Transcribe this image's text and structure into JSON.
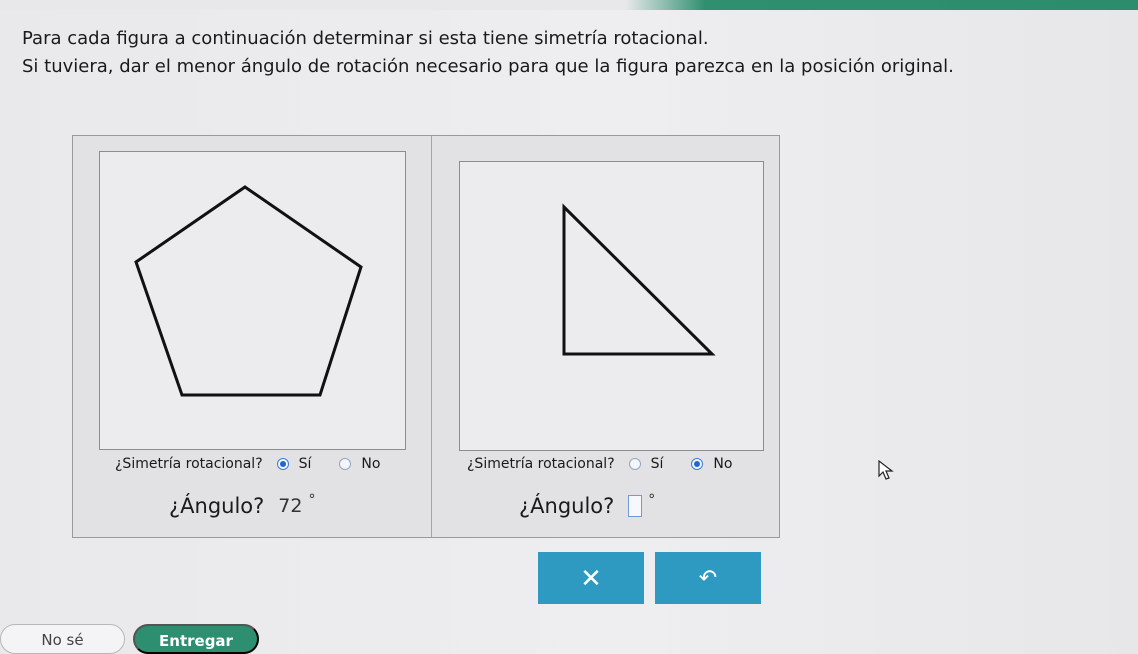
{
  "instructions": {
    "line1": "Para cada figura a continuación determinar si esta tiene simetría rotacional.",
    "line2": "Si tuviera, dar el menor ángulo de rotación necesario para que la figura parezca en la posición original."
  },
  "figures": [
    {
      "shape": "pentagon",
      "question": "¿Simetría rotacional?",
      "option_yes": "Sí",
      "option_no": "No",
      "selected": "Sí",
      "angle_label": "¿Ángulo?",
      "angle_value": "72",
      "degree_symbol": "°"
    },
    {
      "shape": "right-triangle",
      "question": "¿Simetría rotacional?",
      "option_yes": "Sí",
      "option_no": "No",
      "selected": "No",
      "angle_label": "¿Ángulo?",
      "angle_value": "",
      "degree_symbol": "°"
    }
  ],
  "actions": {
    "clear_symbol": "✕",
    "undo_symbol": "↶",
    "dont_know_label": "No sé",
    "submit_label": "Entregar"
  },
  "colors": {
    "accent_button": "#2e9ac1",
    "submit_green": "#2d8f70",
    "radio_selected": "#1f66d1"
  }
}
